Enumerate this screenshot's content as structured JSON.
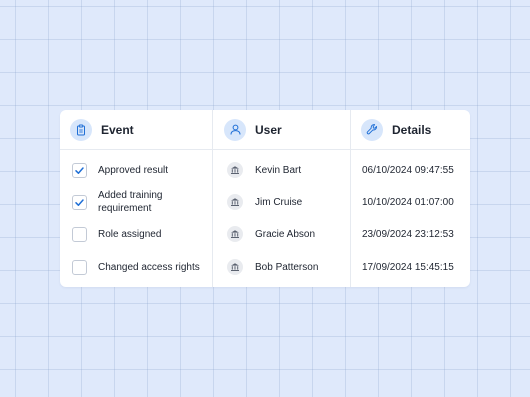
{
  "table": {
    "columns": [
      {
        "label": "Event",
        "icon": "clipboard-icon"
      },
      {
        "label": "User",
        "icon": "user-icon"
      },
      {
        "label": "Details",
        "icon": "wrench-icon"
      }
    ],
    "rows": [
      {
        "event": "Approved result",
        "checked": true,
        "user": "Kevin Bart",
        "details": "06/10/2024 09:47:55"
      },
      {
        "event": "Added training requirement",
        "checked": true,
        "user": "Jim Cruise",
        "details": "10/10/2024 01:07:00"
      },
      {
        "event": "Role assigned",
        "checked": false,
        "user": "Gracie Abson",
        "details": "23/09/2024 23:12:53"
      },
      {
        "event": "Changed access rights",
        "checked": false,
        "user": "Bob Patterson",
        "details": "17/09/2024 15:45:15"
      }
    ]
  },
  "colors": {
    "accent": "#1f6fd6",
    "background": "#dfe9fb",
    "header_icon_bg": "#d7e6fb"
  }
}
